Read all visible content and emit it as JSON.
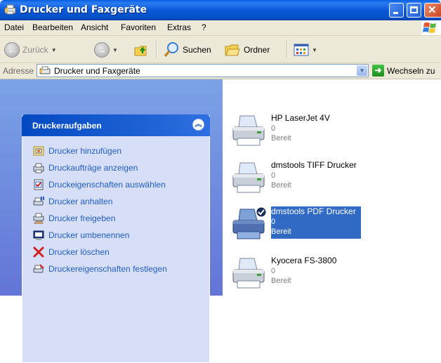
{
  "window": {
    "title": "Drucker und Faxgeräte"
  },
  "menu": [
    "Datei",
    "Bearbeiten",
    "Ansicht",
    "Favoriten",
    "Extras",
    "?"
  ],
  "toolbar": {
    "back_label": "Zurück",
    "search_label": "Suchen",
    "folders_label": "Ordner"
  },
  "address": {
    "label": "Adresse",
    "value": "Drucker und Faxgeräte",
    "go_label": "Wechseln zu"
  },
  "tasks": {
    "title": "Druckeraufgaben",
    "items": [
      {
        "label": "Drucker hinzufügen",
        "icon": "add-printer-icon"
      },
      {
        "label": "Druckaufträge anzeigen",
        "icon": "print-jobs-icon"
      },
      {
        "label": "Druckeigenschaften auswählen",
        "icon": "print-preferences-icon"
      },
      {
        "label": "Drucker anhalten",
        "icon": "pause-printer-icon"
      },
      {
        "label": "Drucker freigeben",
        "icon": "share-printer-icon"
      },
      {
        "label": "Drucker umbenennen",
        "icon": "rename-printer-icon"
      },
      {
        "label": "Drucker löschen",
        "icon": "delete-icon"
      },
      {
        "label": "Druckereigenschaften festlegen",
        "icon": "printer-properties-icon"
      }
    ]
  },
  "printers": [
    {
      "name": "HP LaserJet 4V",
      "jobs": "0",
      "status": "Bereit",
      "selected": false,
      "default": false
    },
    {
      "name": "dmstools TIFF Drucker",
      "jobs": "0",
      "status": "Bereit",
      "selected": false,
      "default": false
    },
    {
      "name": "dmstools PDF Drucker",
      "jobs": "0",
      "status": "Bereit",
      "selected": true,
      "default": true
    },
    {
      "name": "Kyocera FS-3800",
      "jobs": "0",
      "status": "Bereit",
      "selected": false,
      "default": false
    }
  ],
  "colors": {
    "titlebar": "#0a58d8",
    "task_link": "#215dc6",
    "selection": "#316ac5"
  }
}
